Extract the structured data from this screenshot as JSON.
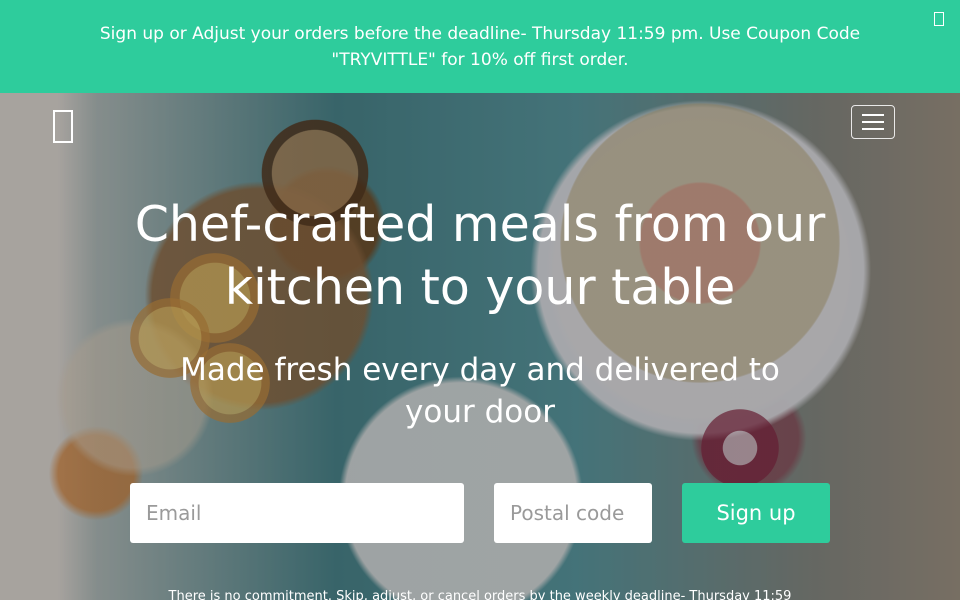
{
  "banner": {
    "text": "Sign up or Adjust your orders before the deadline- Thursday 11:59 pm. Use Coupon Code \"TRYVITTLE\" for 10% off first order.",
    "close_icon": "close-icon",
    "background": "#2ecc9c"
  },
  "nav": {
    "logo_icon": "logo-placeholder-icon",
    "menu_icon": "hamburger-menu-icon"
  },
  "hero": {
    "headline": "Chef-crafted meals from our kitchen to your table",
    "subheadline": "Made fresh every day and delivered to your door",
    "email_placeholder": "Email",
    "postal_placeholder": "Postal code",
    "signup_label": "Sign up",
    "fine_print": "There is no commitment. Skip, adjust, or cancel orders by the weekly deadline- Thursday 11:59"
  },
  "colors": {
    "accent": "#2ecc9c"
  }
}
